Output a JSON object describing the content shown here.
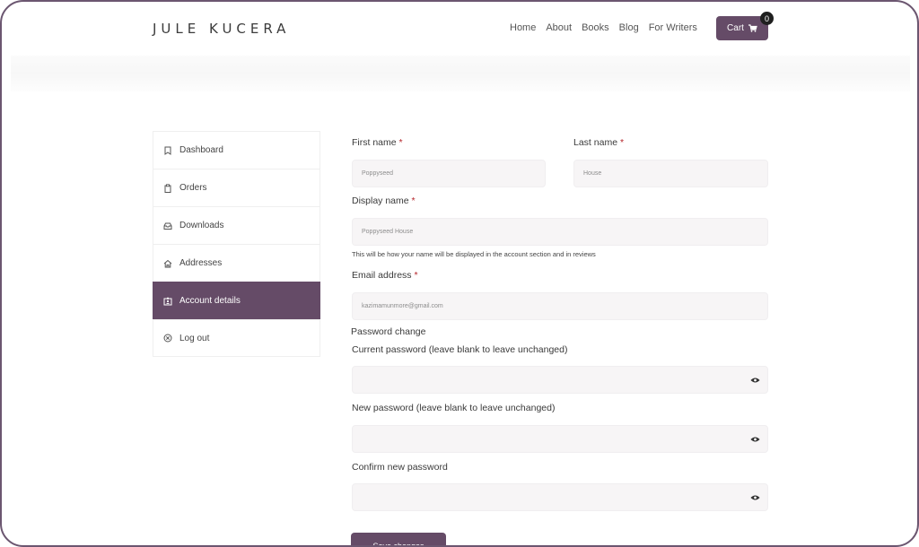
{
  "header": {
    "brand": "JULE KUCERA",
    "nav": [
      "Home",
      "About",
      "Books",
      "Blog",
      "For Writers"
    ],
    "cart_label": "Cart",
    "cart_count": "0"
  },
  "sidebar": {
    "items": [
      {
        "label": "Dashboard",
        "icon": "bookmark-icon"
      },
      {
        "label": "Orders",
        "icon": "clipboard-icon"
      },
      {
        "label": "Downloads",
        "icon": "inbox-icon"
      },
      {
        "label": "Addresses",
        "icon": "home-icon"
      },
      {
        "label": "Account details",
        "icon": "id-card-icon"
      },
      {
        "label": "Log out",
        "icon": "close-circle-icon"
      }
    ],
    "active": "Account details"
  },
  "form": {
    "first_name_label": "First name",
    "first_name_value": "Poppyseed",
    "last_name_label": "Last name",
    "last_name_value": "House",
    "display_name_label": "Display name",
    "display_name_value": "Poppyseed House",
    "display_name_hint": "This will be how your name will be displayed in the account section and in reviews",
    "email_label": "Email address",
    "email_value": "kazimamunmore@gmail.com",
    "password_section": "Password change",
    "current_password_label": "Current password (leave blank to leave unchanged)",
    "new_password_label": "New password (leave blank to leave unchanged)",
    "confirm_password_label": "Confirm new password",
    "required_marker": "*",
    "save_label": "Save changes"
  },
  "colors": {
    "accent": "#654b67",
    "required": "#b5252a",
    "field_bg": "#f7f5f6"
  }
}
